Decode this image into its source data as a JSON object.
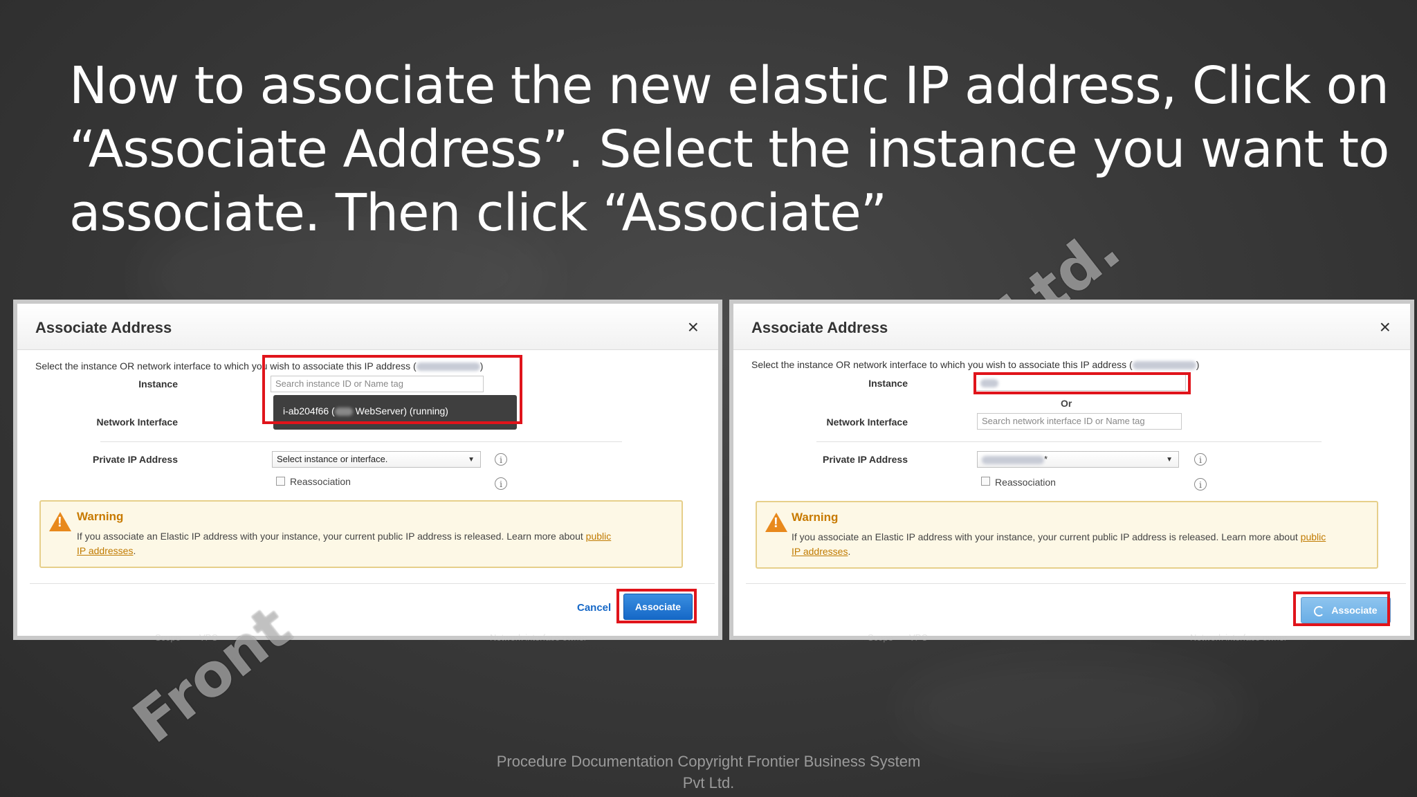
{
  "slide": {
    "headline_lines": [
      "Now to associate the new elastic IP address, Click on",
      "“Associate Address”. Select the instance you want to",
      "associate. Then click “Associate”"
    ],
    "watermark_top": "t Ltd.",
    "watermark_bottom": "Front",
    "footer_line1": "Procedure Documentation Copyright Frontier Business System",
    "footer_line2": "Pvt Ltd.",
    "bg_left_1": "Scope",
    "bg_left_2": "VPC",
    "bg_left_3": "Network interface owner",
    "bg_right_1": "Scope",
    "bg_right_2": "VPC",
    "bg_right_3": "Network interface owner"
  },
  "left_dialog": {
    "title": "Associate Address",
    "close": "×",
    "intro_prefix": "Select the instance OR network interface to which you wish to associate this IP address (",
    "intro_suffix": ")",
    "instance_label": "Instance",
    "instance_placeholder": "Search instance ID or Name tag",
    "dropdown_prefix": "i-ab204f66 (",
    "dropdown_suffix": "WebServer) (running)",
    "network_label": "Network Interface",
    "private_ip_label": "Private IP Address",
    "private_ip_value": "Select instance or interface.",
    "reassociation_label": "Reassociation",
    "warning_title": "Warning",
    "warning_text": "If you associate an Elastic IP address with your instance, your current public IP address is released. Learn more about",
    "warning_link1": "public",
    "warning_link2": "IP addresses",
    "warning_end": ".",
    "cancel_label": "Cancel",
    "associate_label": "Associate"
  },
  "right_dialog": {
    "title": "Associate Address",
    "close": "×",
    "intro_prefix": "Select the instance OR network interface to which you wish to associate this IP address (",
    "intro_suffix": ")",
    "instance_label": "Instance",
    "or_label": "Or",
    "network_label": "Network Interface",
    "network_placeholder": "Search network interface ID or Name tag",
    "private_ip_label": "Private IP Address",
    "private_ip_suffix": "*",
    "reassociation_label": "Reassociation",
    "warning_title": "Warning",
    "warning_text": "If you associate an Elastic IP address with your instance, your current public IP address is released. Learn more about",
    "warning_link1": "public",
    "warning_link2": "IP addresses",
    "warning_end": ".",
    "associate_label": "Associate"
  },
  "icons": {
    "info": "i",
    "warning_mark": "!",
    "caret": "▼"
  },
  "colors": {
    "highlight_red": "#e0141b",
    "primary_blue": "#1668c7",
    "warning_orange": "#e8891c"
  }
}
